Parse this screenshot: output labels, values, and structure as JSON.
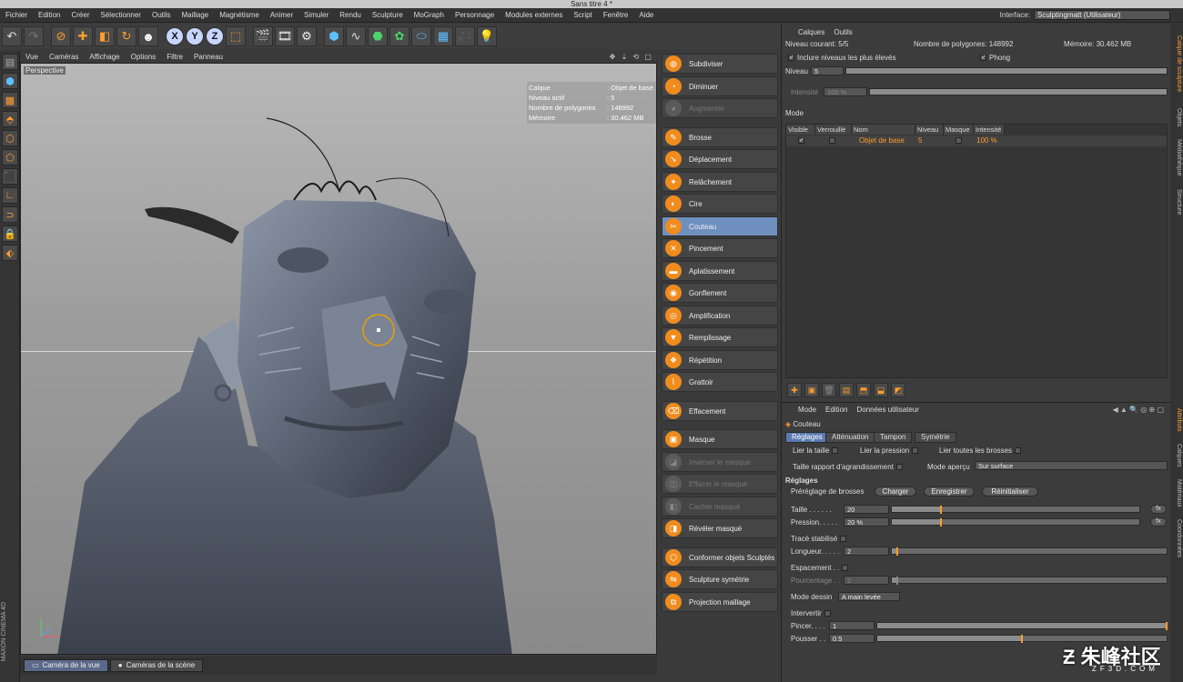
{
  "window_title": "Sans titre 4 *",
  "menu": [
    "Fichier",
    "Edition",
    "Créer",
    "Sélectionner",
    "Outils",
    "Maillage",
    "Magnétisme",
    "Animer",
    "Simuler",
    "Rendu",
    "Sculpture",
    "MoGraph",
    "Personnage",
    "Modules externes",
    "Script",
    "Fenêtre",
    "Aide"
  ],
  "interface_label": "Interface:",
  "interface_value": "Sculptingmatt (Utilisateur)",
  "viewport": {
    "menu": [
      "Vue",
      "Caméras",
      "Affichage",
      "Options",
      "Filtre",
      "Panneau"
    ],
    "label": "Perspective",
    "hud": [
      {
        "k": "Calque",
        "v": ": Objet de base"
      },
      {
        "k": "Niveau actif",
        "v": ": 5"
      },
      {
        "k": "Nombre de polygones",
        "v": ": 148992"
      },
      {
        "k": "Mémoire",
        "v": ": 30.462 MB"
      }
    ],
    "tabs": [
      "Caméra de la vue",
      "Caméras de la scène"
    ]
  },
  "tools": [
    {
      "label": "Subdiviser",
      "state": "normal"
    },
    {
      "label": "Diminuer",
      "state": "normal"
    },
    {
      "label": "Augmenter",
      "state": "disabled"
    },
    {
      "label": "Brosse",
      "state": "normal"
    },
    {
      "label": "Déplacement",
      "state": "normal"
    },
    {
      "label": "Relâchement",
      "state": "normal"
    },
    {
      "label": "Cire",
      "state": "normal"
    },
    {
      "label": "Couteau",
      "state": "active"
    },
    {
      "label": "Pincement",
      "state": "normal"
    },
    {
      "label": "Aplatissement",
      "state": "normal"
    },
    {
      "label": "Gonflement",
      "state": "normal"
    },
    {
      "label": "Amplification",
      "state": "normal"
    },
    {
      "label": "Remplissage",
      "state": "normal"
    },
    {
      "label": "Répétition",
      "state": "normal"
    },
    {
      "label": "Grattoir",
      "state": "normal"
    },
    {
      "label": "Effacement",
      "state": "normal"
    },
    {
      "label": "Masque",
      "state": "normal"
    },
    {
      "label": "Inverser le masque",
      "state": "disabled"
    },
    {
      "label": "Effacer le masque",
      "state": "disabled"
    },
    {
      "label": "Cacher masqué",
      "state": "disabled"
    },
    {
      "label": "Révéler masqué",
      "state": "normal"
    },
    {
      "label": "Conformer objets Sculptés",
      "state": "normal"
    },
    {
      "label": "Sculpture symétrie",
      "state": "normal"
    },
    {
      "label": "Projection maillage",
      "state": "normal"
    }
  ],
  "layers_panel": {
    "menu": [
      "Calques",
      "Outils"
    ],
    "current_level": "Niveau courant: 5/5",
    "polygons": "Nombre de polygones: 148992",
    "memory": "Mémoire: 30.462 MB",
    "include_higher": "Inclure niveaux les plus élevés",
    "phong": "Phong",
    "level_label": "Niveau",
    "level_value": "5",
    "intensity_label": "Intensité",
    "intensity_value": "100 %",
    "mode_label": "Mode",
    "columns": [
      "Visible",
      "Verrouillé",
      "Nom",
      "Niveau",
      "Masque",
      "Intensité"
    ],
    "row": {
      "name": "Objet de base",
      "level": "5",
      "intensity": "100 %"
    }
  },
  "attributes_panel": {
    "menu": [
      "Mode",
      "Edition",
      "Données utilisateur"
    ],
    "object": "Couteau",
    "tabs": [
      "Réglages",
      "Atténuation",
      "Tampon",
      "Symétrie"
    ],
    "link_size": "Lier la taille",
    "link_pressure": "Lier la pression",
    "link_all": "Lier toutes les brosses",
    "size_ratio": "Taille rapport d'agrandissement",
    "preview_mode": "Mode aperçu",
    "preview_value": "Sur surface",
    "section": "Réglages",
    "preset_label": "Préréglage de brosses",
    "buttons": [
      "Charger",
      "Enregistrer",
      "Réinitialiser"
    ],
    "size_label": "Taille . . . . . .",
    "size_value": "20",
    "size_fraction": 0.2,
    "pressure_label": "Pression. . . . .",
    "pressure_value": "20 %",
    "pressure_fraction": 0.2,
    "fx": "fx",
    "stabilized": "Tracé stabilisé",
    "length_label": "Longueur. . . . .",
    "length_value": "2",
    "length_fraction": 0.02,
    "spacing": "Espacement . .",
    "percent_label": "Pourcentage . .",
    "percent_value": "2",
    "percent_fraction": 0.02,
    "draw_mode_label": "Mode dessin",
    "draw_mode_value": "A main levée",
    "invert": "Intervertir",
    "pinch_label": "Pincer. . . .",
    "pinch_value": "1",
    "pinch_fraction": 1.0,
    "push_label": "Pousser . .",
    "push_value": "0.5",
    "push_fraction": 0.5
  },
  "side_tabs": [
    "Calque de sculpture",
    "Objets",
    "Médiathèque",
    "Structure"
  ],
  "side_tabs_bottom": [
    "Attributs",
    "Calques",
    "Matériaux",
    "Coordonnées"
  ],
  "watermark": "朱峰社区",
  "watermark_sub": "ZF3D.COM"
}
